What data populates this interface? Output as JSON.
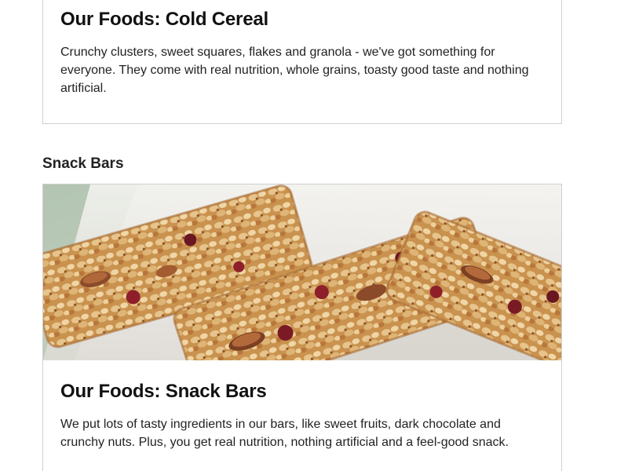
{
  "cereal_card": {
    "title": "Our Foods: Cold Cereal",
    "description": "Crunchy clusters, sweet squares, flakes and granola - we've got something for everyone. They come with real nutrition, whole grains, toasty good taste and nothing artificial."
  },
  "snack_section": {
    "heading": "Snack Bars"
  },
  "snack_card": {
    "image_alt": "granola-bars-photo",
    "title": "Our Foods: Snack Bars",
    "description": "We put lots of tasty ingredients in our bars, like sweet fruits, dark chocolate and crunchy nuts. Plus, you get real nutrition, nothing artificial and a feel-good snack."
  }
}
